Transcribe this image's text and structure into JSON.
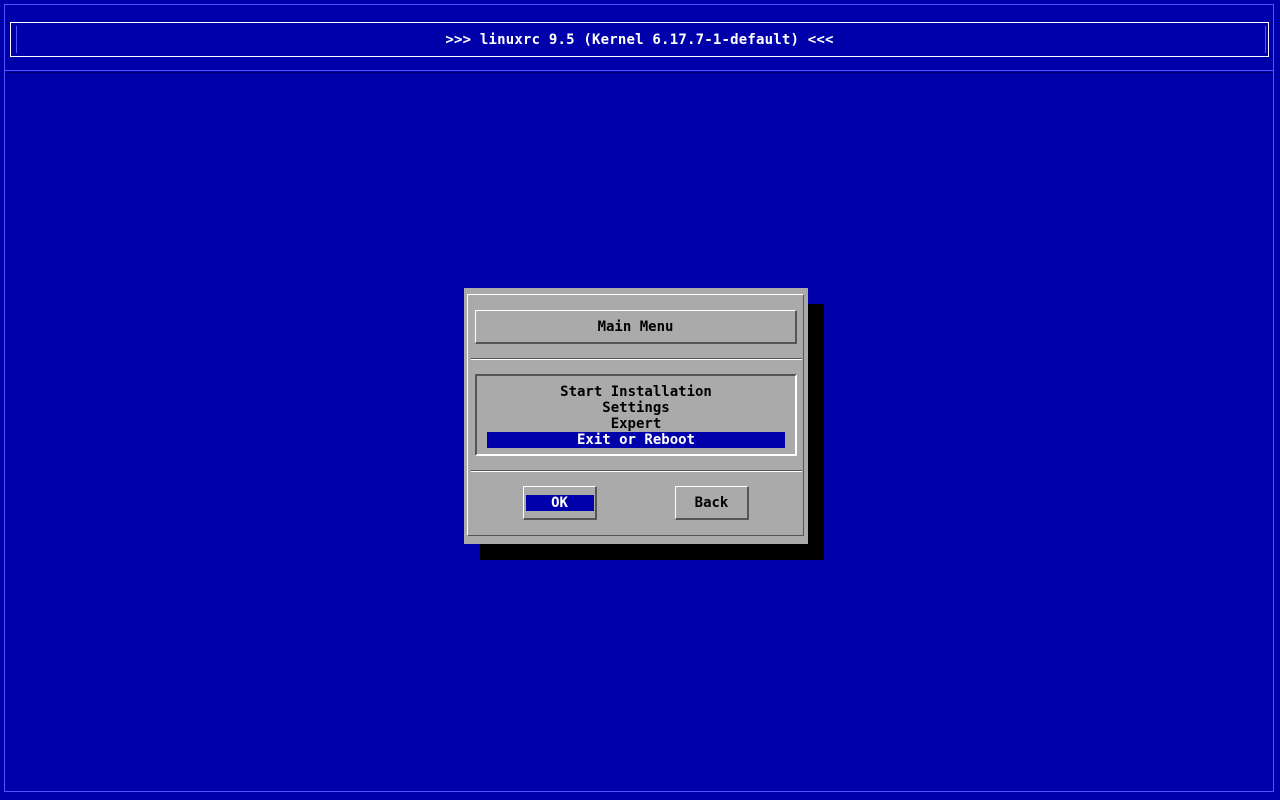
{
  "header": {
    "title": ">>> linuxrc 9.5 (Kernel 6.17.7-1-default) <<<"
  },
  "dialog": {
    "title": "Main Menu",
    "menu_items": [
      {
        "label": "Start Installation",
        "selected": false
      },
      {
        "label": "Settings",
        "selected": false
      },
      {
        "label": "Expert",
        "selected": false
      },
      {
        "label": "Exit or Reboot",
        "selected": true
      }
    ],
    "buttons": {
      "ok_label": "OK",
      "back_label": "Back"
    }
  },
  "colors": {
    "background": "#0000aa",
    "dialog": "#aaaaaa",
    "highlight": "#0000aa",
    "highlight_text": "#ffffff",
    "shadow": "#000000"
  }
}
